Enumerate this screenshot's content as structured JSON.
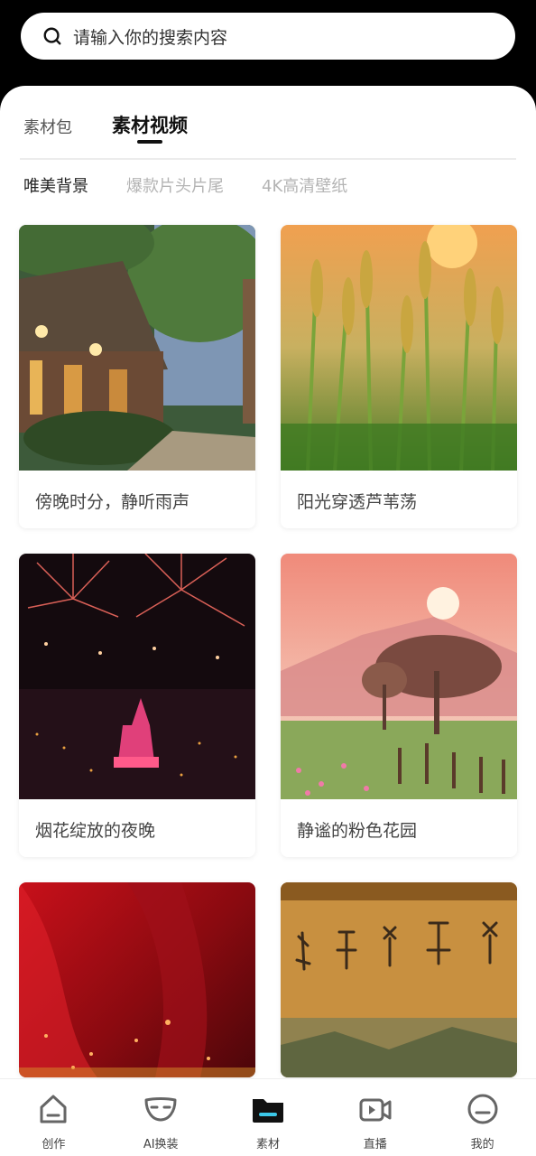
{
  "search": {
    "placeholder": "请输入你的搜索内容"
  },
  "tabs": [
    {
      "label": "素材包"
    },
    {
      "label": "素材视频"
    }
  ],
  "subtabs": [
    {
      "label": "唯美背景"
    },
    {
      "label": "爆款片头片尾"
    },
    {
      "label": "4K高清壁纸"
    }
  ],
  "cards": [
    {
      "title": "傍晚时分，静听雨声"
    },
    {
      "title": "阳光穿透芦苇荡"
    },
    {
      "title": "烟花绽放的夜晚"
    },
    {
      "title": "静谧的粉色花园"
    },
    {
      "title": ""
    },
    {
      "title": ""
    }
  ],
  "nav": [
    {
      "label": "创作",
      "icon": "home-icon"
    },
    {
      "label": "AI换装",
      "icon": "mask-icon"
    },
    {
      "label": "素材",
      "icon": "folder-icon"
    },
    {
      "label": "直播",
      "icon": "video-icon"
    },
    {
      "label": "我的",
      "icon": "profile-icon"
    }
  ],
  "colors": {
    "accent": "#3cc8e8",
    "text_active": "#111111",
    "text_inactive": "#b4b4b4"
  }
}
